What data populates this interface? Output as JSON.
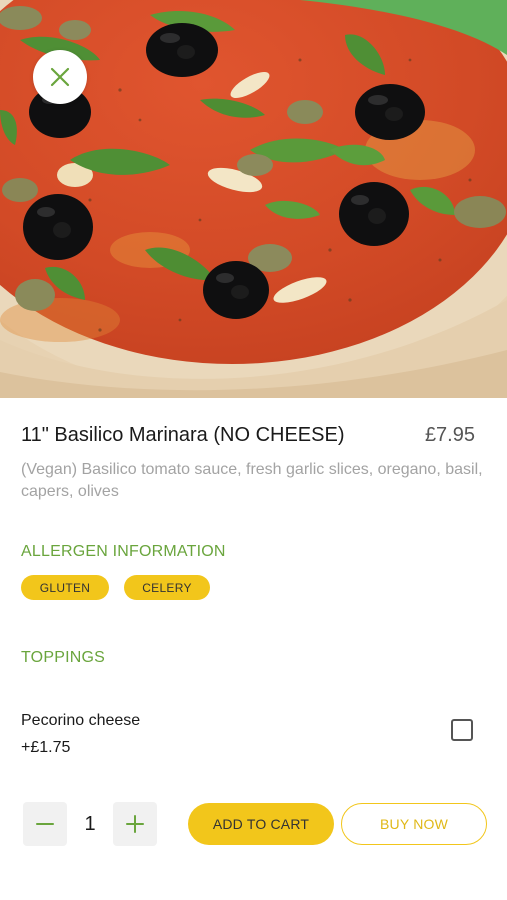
{
  "product": {
    "title": "11\" Basilico Marinara (NO CHEESE)",
    "price": "£7.95",
    "description": "(Vegan) Basilico tomato sauce, fresh garlic slices, oregano, basil, capers, olives"
  },
  "allergens": {
    "heading": "ALLERGEN INFORMATION",
    "items": [
      "GLUTEN",
      "CELERY"
    ]
  },
  "toppings": {
    "heading": "TOPPINGS",
    "items": [
      {
        "name": "Pecorino cheese",
        "price": "+£1.75",
        "checked": false
      }
    ]
  },
  "cart": {
    "quantity": "1",
    "add_label": "ADD TO CART",
    "buy_label": "BUY NOW"
  },
  "colors": {
    "accent_yellow": "#f2c61b",
    "accent_green": "#6aa53d",
    "muted_text": "#a3a3a3"
  },
  "icons": {
    "close": "close-icon",
    "minus": "minus-icon",
    "plus": "plus-icon"
  }
}
